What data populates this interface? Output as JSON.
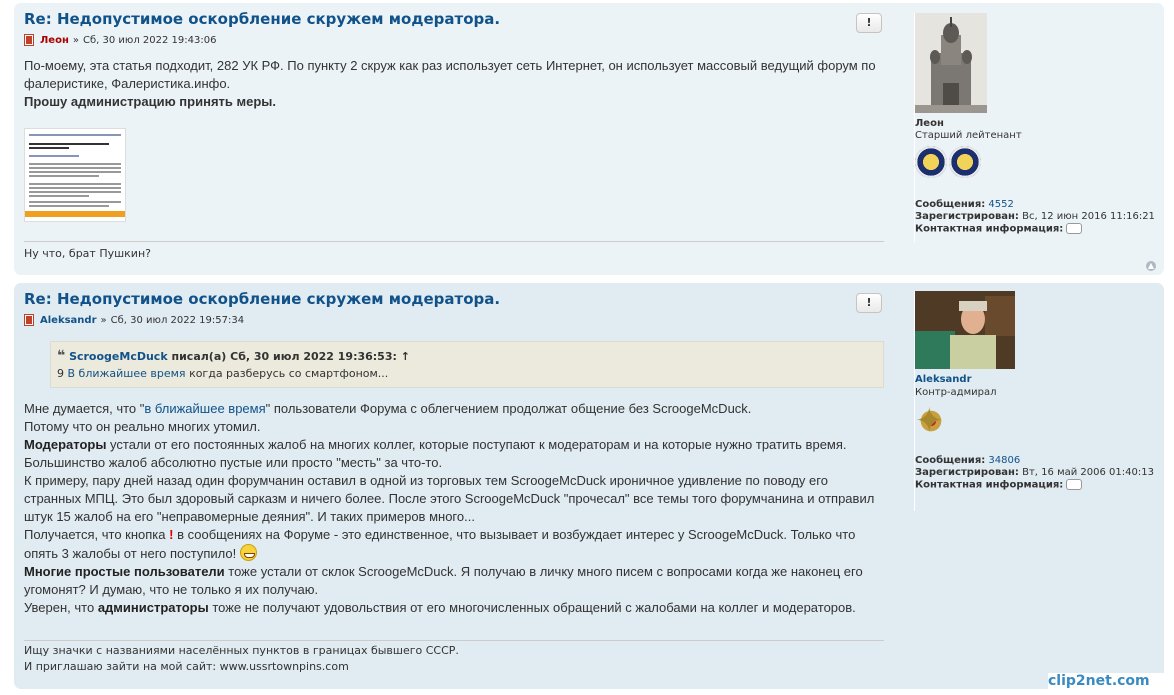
{
  "posts": [
    {
      "title": "Re: Недопустимое оскорбление скружем модератора.",
      "author": "Леон",
      "date_sep": "»",
      "date": "Сб, 30 июл 2022 19:43:06",
      "report_label": "!",
      "body": {
        "p1": "По-моему, эта статья подходит, 282 УК РФ. По пункту 2 скруж как раз использует сеть Интернет, он использует массовый ведущий форум по фалеристике, Фалеристика.инфо.",
        "p2": "Прошу администрацию принять меры."
      },
      "signature": "Ну что, брат Пушкин?",
      "profile": {
        "name": "Леон",
        "rank": "Старший лейтенант",
        "messages_label": "Сообщения:",
        "messages": "4552",
        "registered_label": "Зарегистрирован:",
        "registered": "Вс, 12 июн 2016 11:16:21",
        "contact_label": "Контактная информация:"
      }
    },
    {
      "title": "Re: Недопустимое оскорбление скружем модератора.",
      "author": "Aleksandr",
      "date_sep": "»",
      "date": "Сб, 30 июл 2022 19:57:34",
      "report_label": "!",
      "quote": {
        "mark": "❝",
        "who": "ScroogeMcDuck",
        "wrote": "писал(а)",
        "date": "Сб, 30 июл 2022 19:36:53:",
        "arrow": "↑",
        "num": "9",
        "link": "В ближайшее время",
        "rest": "когда разберусь со смартфоном..."
      },
      "body": {
        "l1_a": "Мне думается, что \"",
        "l1_link": "в ближайшее время",
        "l1_b": "\" пользователи Форума с облегчением продолжат общение без ScroogeMcDuck.",
        "l2": "Потому что он реально многих утомил.",
        "l3_b": "Модераторы",
        "l3": " устали от его постоянных жалоб на многих коллег, которые поступают к модераторам и на которые нужно тратить время.",
        "l4": "Большинство жалоб абсолютно пустые или просто \"месть\" за что-то.",
        "l5": "К примеру, пару дней назад один форумчанин оставил в одной из торговых тем ScroogeMcDuck ироничное удивление по поводу его странных МПЦ. Это был здоровый сарказм и ничего более. После этого ScroogeMcDuck \"прочесал\" все темы того форумчанина и отправил штук 15 жалоб на его \"неправомерные деяния\". И таких примеров много...",
        "l6_a": "Получается, что кнопка",
        "l6_warn": "!",
        "l6_b": "в сообщениях на Форуме - это единственное, что вызывает и возбуждает интерес у ScroogeMcDuck. Только что опять 3 жалобы от него поступило!",
        "l7_b": "Многие простые пользователи",
        "l7": " тоже устали от склок ScroogeMcDuck. Я получаю в личку много писем с вопросами когда же наконец его угомонят? И думаю, что не только я их получаю.",
        "l8_a": "Уверен, что ",
        "l8_b": "администраторы",
        "l8_c": " тоже не получают удовольствия от его многочисленных обращений с жалобами на коллег и модераторов."
      },
      "signature": {
        "line1": "Ищу значки с названиями населённых пунктов в границах бывшего СССР.",
        "line2": "И приглашаю зайти на мой сайт: www.ussrtownpins.com"
      },
      "profile": {
        "name": "Aleksandr",
        "rank": "Контр-адмирал",
        "messages_label": "Сообщения:",
        "messages": "34806",
        "registered_label": "Зарегистрирован:",
        "registered": "Вт, 16 май 2006 01:40:13",
        "contact_label": "Контактная информация:"
      }
    }
  ],
  "watermark": "clip2net.com",
  "icons": [
    "post-icon",
    "report-icon",
    "quote-icon",
    "contact-icon",
    "back-to-top-icon",
    "smiley-icon",
    "medal-icon"
  ]
}
